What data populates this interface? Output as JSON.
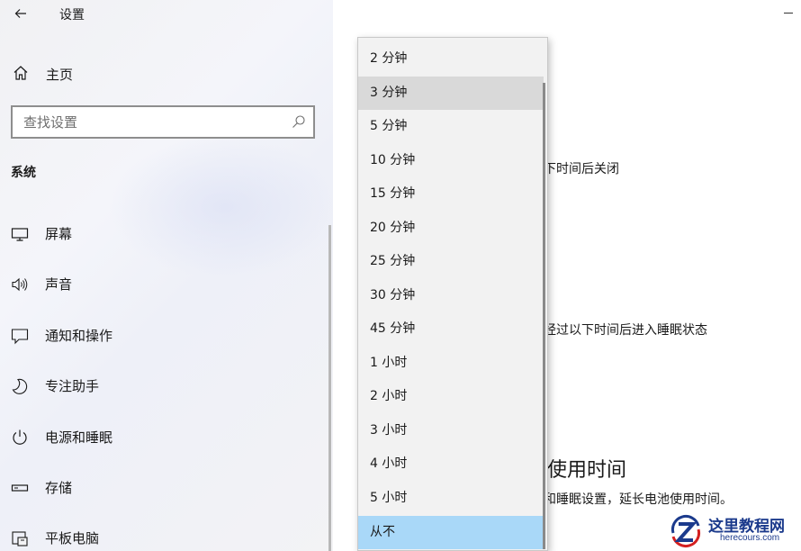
{
  "app": {
    "title": "设置"
  },
  "sidebar": {
    "home_label": "主页",
    "search_placeholder": "查找设置",
    "section_title": "系统",
    "items": [
      {
        "label": "屏幕",
        "icon": "monitor-icon"
      },
      {
        "label": "声音",
        "icon": "speaker-icon"
      },
      {
        "label": "通知和操作",
        "icon": "notification-icon"
      },
      {
        "label": "专注助手",
        "icon": "moon-icon"
      },
      {
        "label": "电源和睡眠",
        "icon": "power-icon"
      },
      {
        "label": "存储",
        "icon": "storage-icon"
      },
      {
        "label": "平板电脑",
        "icon": "tablet-icon"
      }
    ]
  },
  "content": {
    "screen_off_text": "下时间后关闭",
    "sleep_text": "经过以下时间后进入睡眠状态",
    "battery_heading": "使用时间",
    "battery_desc": "和睡眠设置，延长电池使用时间。"
  },
  "dropdown": {
    "hover_index": 1,
    "selected_index": 14,
    "options": [
      "2 分钟",
      "3 分钟",
      "5 分钟",
      "10 分钟",
      "15 分钟",
      "20 分钟",
      "25 分钟",
      "30 分钟",
      "45 分钟",
      "1 小时",
      "2 小时",
      "3 小时",
      "4 小时",
      "5 小时",
      "从不"
    ]
  },
  "watermark": {
    "cn": "这里教程网",
    "en": "herecours.com"
  },
  "colors": {
    "selected": "#a9d8f8",
    "hover": "#d9d9d9",
    "watermark": "#1b3a8c"
  }
}
